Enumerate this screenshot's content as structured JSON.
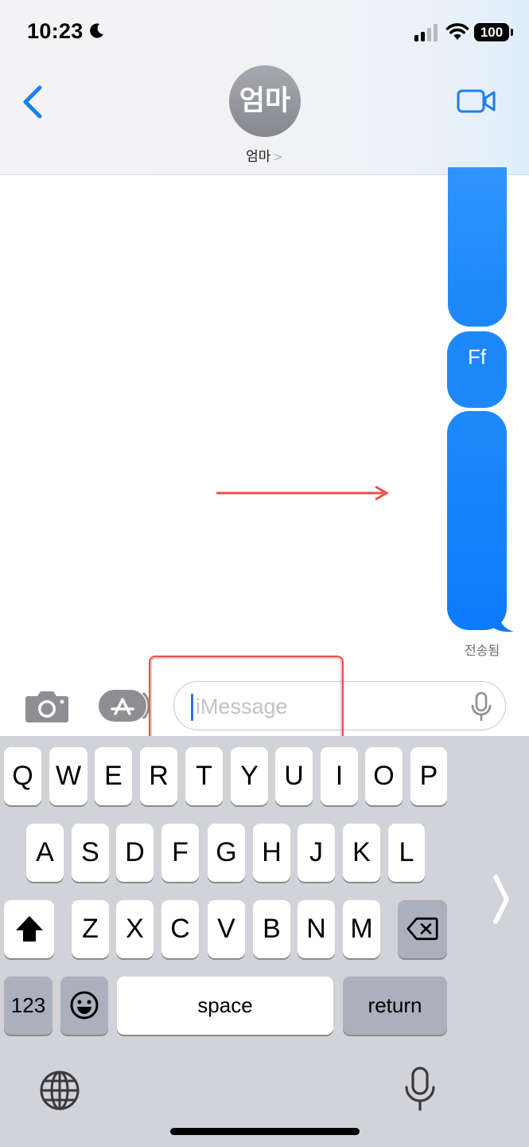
{
  "status_bar": {
    "time": "10:23",
    "battery": "100"
  },
  "header": {
    "avatar_initials": "엄마",
    "contact_name": "엄마",
    "contact_chevron": ">"
  },
  "messages": [
    {
      "text": ""
    },
    {
      "text": "Ff"
    },
    {
      "text": ""
    }
  ],
  "delivery_status": "전송됨",
  "composer": {
    "placeholder": "iMessage"
  },
  "keyboard": {
    "row1": [
      "Q",
      "W",
      "E",
      "R",
      "T",
      "Y",
      "U",
      "I",
      "O",
      "P"
    ],
    "row2": [
      "A",
      "S",
      "D",
      "F",
      "G",
      "H",
      "J",
      "K",
      "L"
    ],
    "row3": [
      "Z",
      "X",
      "C",
      "V",
      "B",
      "N",
      "M"
    ],
    "numbers_label": "123",
    "space_label": "space",
    "return_label": "return"
  },
  "colors": {
    "bubble": "#1a87fb",
    "accent": "#1a7ff1",
    "annotation": "#e8504f"
  }
}
